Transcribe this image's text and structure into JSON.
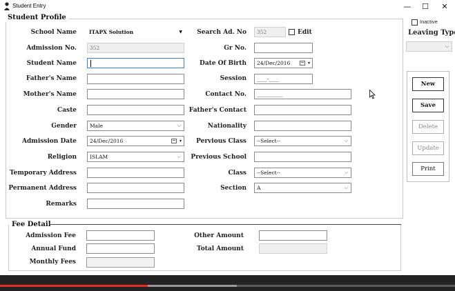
{
  "window": {
    "title": "Student Entry",
    "minimize": "—",
    "maximize": "☐",
    "close": "✕"
  },
  "student_profile": {
    "title": "Student Profile",
    "school_name": {
      "label": "School Name",
      "value": "ITAPX Solution"
    },
    "admission_no": {
      "label": "Admission No.",
      "value": "352"
    },
    "student_name": {
      "label": "Student Name",
      "value": ""
    },
    "fathers_name": {
      "label": "Father's Name",
      "value": ""
    },
    "mothers_name": {
      "label": "Mother's Name",
      "value": ""
    },
    "caste": {
      "label": "Caste",
      "value": ""
    },
    "gender": {
      "label": "Gender",
      "value": "Male"
    },
    "admission_date": {
      "label": "Admission Date",
      "value": "24/Dec/2016"
    },
    "religion": {
      "label": "Religion",
      "value": "ISLAM"
    },
    "temporary_address": {
      "label": "Temporary Address",
      "value": ""
    },
    "permanent_address": {
      "label": "Permanent Address",
      "value": ""
    },
    "remarks": {
      "label": "Remarks",
      "value": ""
    },
    "search_ad_no": {
      "label": "Search Ad. No",
      "value": "352"
    },
    "edit": {
      "label": "Edit",
      "checked": false
    },
    "gr_no": {
      "label": "Gr No.",
      "value": ""
    },
    "date_of_birth": {
      "label": "Date Of Birth",
      "value": "24/Dec/2016"
    },
    "session": {
      "label": "Session",
      "value": "____-____"
    },
    "contact_no": {
      "label": "Contact No.",
      "value": "__________"
    },
    "fathers_contact": {
      "label": "Father's Contact",
      "value": ""
    },
    "nationality": {
      "label": "Nationality",
      "value": ""
    },
    "pervious_class": {
      "label": "Pervious Class",
      "value": "--Select--"
    },
    "previous_school": {
      "label": "Previous School",
      "value": ""
    },
    "class": {
      "label": "Class",
      "value": "--Select--"
    },
    "section": {
      "label": "Section",
      "value": "A"
    }
  },
  "right_panel": {
    "inactive": {
      "label": "Inactive",
      "checked": false
    },
    "leaving_type": {
      "label": "Leaving Type",
      "value": ""
    }
  },
  "buttons": {
    "new": "New",
    "save": "Save",
    "delete": "Delete",
    "update": "Update",
    "print": "Print"
  },
  "fee_detail": {
    "title": "Fee Detail",
    "admission_fee": {
      "label": "Admission Fee",
      "value": ""
    },
    "annual_fund": {
      "label": "Annual Fund",
      "value": ""
    },
    "monthly_fees": {
      "label": "Monthly Fees",
      "value": ""
    },
    "other_amount": {
      "label": "Other Amount",
      "value": ""
    },
    "total_amount": {
      "label": "Total Amount",
      "value": ""
    }
  },
  "video_player": {
    "progress": 0.325,
    "buffered": 0.52,
    "colors": {
      "played": "#e52d27",
      "buffered": "#9a9a9a",
      "track": "#5a5a5a"
    }
  },
  "icons": [
    "app-icon",
    "minimize-icon",
    "maximize-icon",
    "close-icon",
    "calendar-icon",
    "chevron-down-icon",
    "mouse-cursor-icon"
  ]
}
